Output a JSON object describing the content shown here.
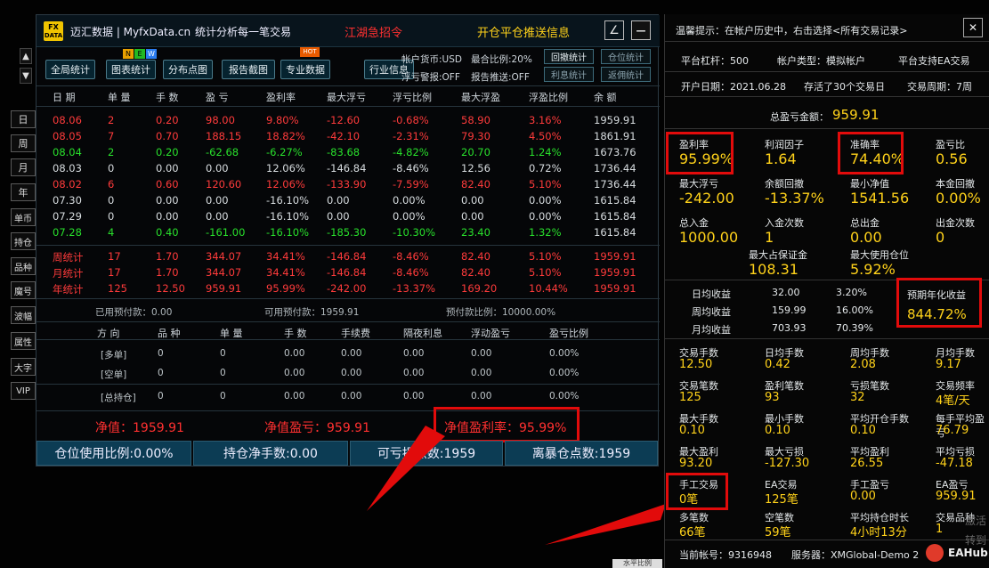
{
  "left_tabs": [
    "日",
    "周",
    "月",
    "年",
    "单币",
    "持仓",
    "品种",
    "魔号",
    "波幅",
    "属性",
    "大字",
    "VIP"
  ],
  "nav_arrows": {
    "up": "▲",
    "down": "▼"
  },
  "titlebar": {
    "logo_top": "FX",
    "logo_bottom": "DATA",
    "app": "迈汇数据 | MyfxData.cn",
    "slogan": "统计分析每一笔交易",
    "recruit": "江湖急招令",
    "push": "开仓平仓推送信息",
    "edit_icon": "∠",
    "min_icon": "—"
  },
  "badges": {
    "n": "N",
    "e": "E",
    "w": "W",
    "hot": "HOT"
  },
  "toolbar": {
    "buttons": [
      "全局统计",
      "图表统计",
      "分布点图",
      "报告截图",
      "专业数据",
      "行业信息"
    ],
    "info": {
      "currency": "帐户货币:USD",
      "max_loss": "最合比例:20%",
      "float_warn": "浮亏警报:OFF",
      "report_push": "报告推送:OFF"
    },
    "small_buttons": [
      "回撤统计",
      "仓位统计",
      "利息统计",
      "返佣统计"
    ]
  },
  "table": {
    "headers": [
      "日 期",
      "单 量",
      "手 数",
      "盈 亏",
      "盈利率",
      "最大浮亏",
      "浮亏比例",
      "最大浮盈",
      "浮盈比例",
      "余 额"
    ],
    "rows": [
      {
        "c": "red",
        "v": [
          "08.06",
          "2",
          "0.20",
          "98.00",
          "9.80%",
          "-12.60",
          "-0.68%",
          "58.90",
          "3.16%",
          "1959.91"
        ]
      },
      {
        "c": "red",
        "v": [
          "08.05",
          "7",
          "0.70",
          "188.15",
          "18.82%",
          "-42.10",
          "-2.31%",
          "79.30",
          "4.50%",
          "1861.91"
        ]
      },
      {
        "c": "grn",
        "v": [
          "08.04",
          "2",
          "0.20",
          "-62.68",
          "-6.27%",
          "-83.68",
          "-4.82%",
          "20.70",
          "1.24%",
          "1673.76"
        ]
      },
      {
        "c": "gry",
        "v": [
          "08.03",
          "0",
          "0.00",
          "0.00",
          "12.06%",
          "-146.84",
          "-8.46%",
          "12.56",
          "0.72%",
          "1736.44"
        ]
      },
      {
        "c": "red",
        "v": [
          "08.02",
          "6",
          "0.60",
          "120.60",
          "12.06%",
          "-133.90",
          "-7.59%",
          "82.40",
          "5.10%",
          "1736.44"
        ]
      },
      {
        "c": "gry",
        "v": [
          "07.30",
          "0",
          "0.00",
          "0.00",
          "-16.10%",
          "0.00",
          "0.00%",
          "0.00",
          "0.00%",
          "1615.84"
        ]
      },
      {
        "c": "gry",
        "v": [
          "07.29",
          "0",
          "0.00",
          "0.00",
          "-16.10%",
          "0.00",
          "0.00%",
          "0.00",
          "0.00%",
          "1615.84"
        ]
      },
      {
        "c": "grn",
        "v": [
          "07.28",
          "4",
          "0.40",
          "-161.00",
          "-16.10%",
          "-185.30",
          "-10.30%",
          "23.40",
          "1.32%",
          "1615.84"
        ]
      }
    ],
    "summary": [
      {
        "c": "red",
        "v": [
          "周统计",
          "17",
          "1.70",
          "344.07",
          "34.41%",
          "-146.84",
          "-8.46%",
          "82.40",
          "5.10%",
          "1959.91"
        ]
      },
      {
        "c": "red",
        "v": [
          "月统计",
          "17",
          "1.70",
          "344.07",
          "34.41%",
          "-146.84",
          "-8.46%",
          "82.40",
          "5.10%",
          "1959.91"
        ]
      },
      {
        "c": "red",
        "v": [
          "年统计",
          "125",
          "12.50",
          "959.91",
          "95.99%",
          "-242.00",
          "-13.37%",
          "169.20",
          "10.44%",
          "1959.91"
        ]
      }
    ]
  },
  "margin": {
    "used": "已用预付款：0.00",
    "available": "可用预付款：1959.91",
    "ratio": "预付款比例：10000.00%"
  },
  "positions": {
    "headers": [
      "方 向",
      "品 种",
      "单 量",
      "手 数",
      "手续费",
      "隔夜利息",
      "浮动盈亏",
      "盈亏比例"
    ],
    "rows": [
      [
        "[多单]",
        "0",
        "0",
        "0.00",
        "0.00",
        "0.00",
        "0.00",
        "0.00%"
      ],
      [
        "[空单]",
        "0",
        "0",
        "0.00",
        "0.00",
        "0.00",
        "0.00",
        "0.00%"
      ],
      [
        "[总持仓]",
        "0",
        "0",
        "0.00",
        "0.00",
        "0.00",
        "0.00",
        "0.00%"
      ]
    ]
  },
  "equity": {
    "value": "净值：1959.91",
    "profit": "净值盈亏：959.91",
    "rate": "净值盈利率：95.99%"
  },
  "footer": {
    "pos_ratio": "仓位使用比例:0.00%",
    "net_lots": "持仓净手数:0.00",
    "loss_pts": "可亏损点数:1959",
    "liq_pts": "离暴仓点数:1959"
  },
  "right": {
    "tip": "温馨提示：在帐户历史中，右击选择<所有交易记录>",
    "close_icon": "✕",
    "info1": [
      "平台杠杆：500",
      "帐户类型：模拟帐户",
      "平台支持EA交易"
    ],
    "info2": [
      "开户日期：2021.06.28",
      "存活了30个交易日",
      "交易周期：7周"
    ],
    "total_label": "总盈亏金额：",
    "total_value": "959.91",
    "grid1": [
      [
        "盈利率",
        "95.99%"
      ],
      [
        "利润因子",
        "1.64"
      ],
      [
        "准确率",
        "74.40%"
      ],
      [
        "盈亏比",
        "0.56"
      ],
      [
        "最大浮亏",
        "-242.00"
      ],
      [
        "余额回撤",
        "-13.37%"
      ],
      [
        "最小净值",
        "1541.56"
      ],
      [
        "本金回撤",
        "0.00%"
      ],
      [
        "总入金",
        "1000.00"
      ],
      [
        "入金次数",
        "1"
      ],
      [
        "总出金",
        "0.00"
      ],
      [
        "出金次数",
        "0"
      ]
    ],
    "grid1b": [
      [
        "最大占保证金",
        "108.31"
      ],
      [
        "最大使用仓位",
        "5.92%"
      ]
    ],
    "avg": [
      [
        "日均收益",
        "32.00",
        "3.20%"
      ],
      [
        "周均收益",
        "159.99",
        "16.00%"
      ],
      [
        "月均收益",
        "703.93",
        "70.39%"
      ]
    ],
    "annual_label": "预期年化收益",
    "annual_value": "844.72%",
    "grid2": [
      [
        "交易手数",
        "12.50"
      ],
      [
        "日均手数",
        "0.42"
      ],
      [
        "周均手数",
        "2.08"
      ],
      [
        "月均手数",
        "9.17"
      ],
      [
        "交易笔数",
        "125"
      ],
      [
        "盈利笔数",
        "93"
      ],
      [
        "亏损笔数",
        "32"
      ],
      [
        "交易频率",
        "4笔/天"
      ],
      [
        "最大手数",
        "0.10"
      ],
      [
        "最小手数",
        "0.10"
      ],
      [
        "平均开仓手数",
        "0.10"
      ],
      [
        "每手平均盈亏",
        "76.79"
      ],
      [
        "最大盈利",
        "93.20"
      ],
      [
        "最大亏损",
        "-127.30"
      ],
      [
        "平均盈利",
        "26.55"
      ],
      [
        "平均亏损",
        "-47.18"
      ],
      [
        "手工交易",
        "0笔"
      ],
      [
        "EA交易",
        "125笔"
      ],
      [
        "手工盈亏",
        "0.00"
      ],
      [
        "EA盈亏",
        "959.91"
      ],
      [
        "多笔数",
        "66笔"
      ],
      [
        "空笔数",
        "59笔"
      ],
      [
        "平均持仓时长",
        "4小时13分"
      ],
      [
        "交易品种",
        "1"
      ]
    ],
    "account": "当前帐号：9316948",
    "server": "服务器：XMGlobal-Demo 2",
    "brand": "EAHub",
    "watermark": "激活 转到"
  },
  "bottom_tab": "水平比例",
  "colors": {
    "accent_red": "#e20b0b",
    "value_yellow": "#ffd21a",
    "profit_red": "#ff3b3b",
    "loss_green": "#29e02c"
  }
}
